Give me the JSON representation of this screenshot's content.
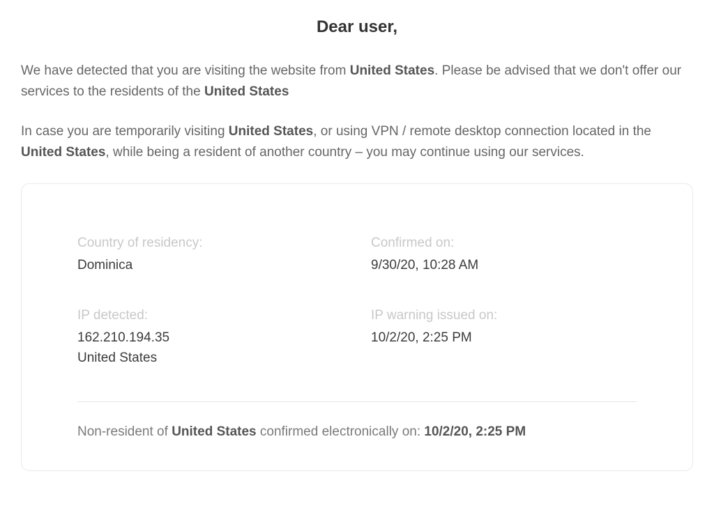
{
  "heading": "Dear user,",
  "para1": {
    "pre": "We have detected that you are visiting the website from ",
    "country1": "United States",
    "mid": ". Please be advised that we don't offer our services to the residents of the ",
    "country2": "United States"
  },
  "para2": {
    "pre": "In case you are temporarily visiting ",
    "country1": "United States",
    "mid1": ", or using VPN / remote desktop connection located in the ",
    "country2": "United States",
    "mid2": ", while being a resident of another country – you may continue using our services."
  },
  "fields": {
    "residency_label": "Country of residency:",
    "residency_value": "Dominica",
    "confirmed_label": "Confirmed on:",
    "confirmed_value": "9/30/20, 10:28 AM",
    "ip_label": "IP detected:",
    "ip_value_line1": "162.210.194.35",
    "ip_value_line2": "United States",
    "warning_label": "IP warning issued on:",
    "warning_value": "10/2/20, 2:25 PM"
  },
  "confirm": {
    "pre": "Non-resident of ",
    "country": "United States",
    "mid": " confirmed electronically on: ",
    "timestamp": "10/2/20, 2:25 PM"
  }
}
